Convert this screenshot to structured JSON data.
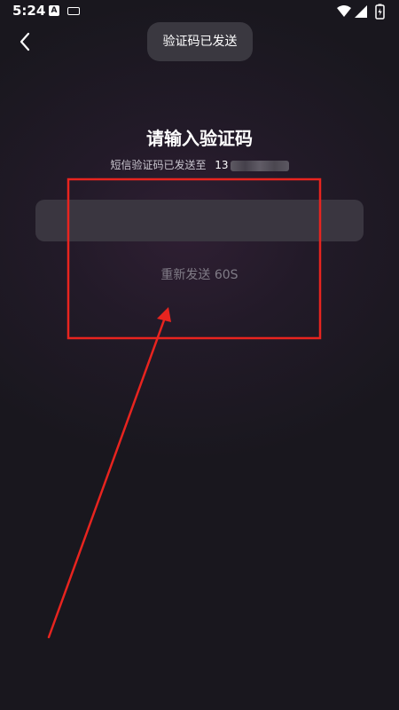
{
  "status_bar": {
    "time": "5:24",
    "icons": [
      "a-notification-icon",
      "keyboard-icon",
      "wifi-icon",
      "signal-icon",
      "battery-icon"
    ]
  },
  "toast": {
    "text": "验证码已发送"
  },
  "header": {
    "back_icon": "chevron-left-icon"
  },
  "main": {
    "title": "请输入验证码",
    "subtitle_prefix": "短信验证码已发送至",
    "phone_visible": "13",
    "code_input_value": "",
    "resend_label": "重新发送 60S"
  },
  "colors": {
    "background": "#19171e",
    "input_background": "#3a3640",
    "toast_background": "#3a3840",
    "annotation_red": "#e8241f",
    "resend_text": "#807c87"
  }
}
